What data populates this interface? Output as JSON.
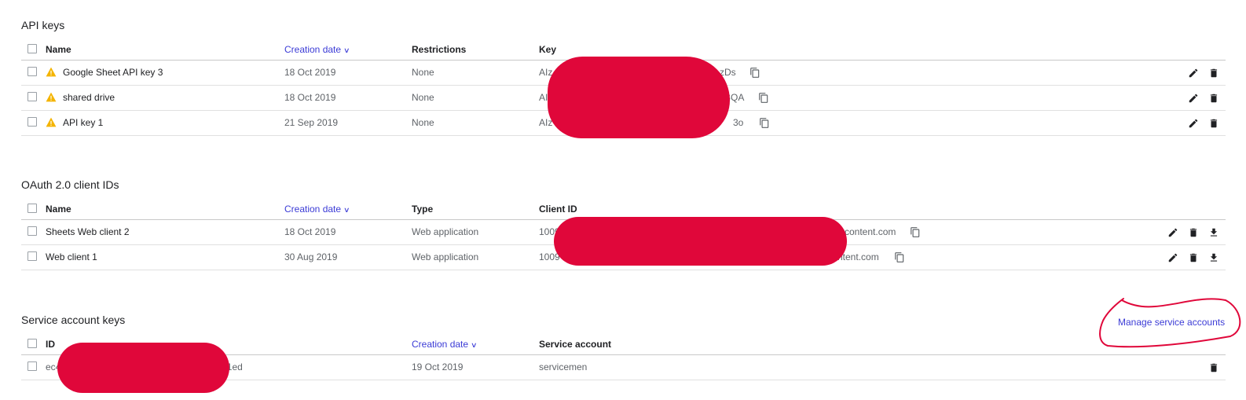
{
  "api_keys": {
    "title": "API keys",
    "headers": {
      "name": "Name",
      "creation_date": "Creation date",
      "restrictions": "Restrictions",
      "key": "Key"
    },
    "rows": [
      {
        "name": "Google Sheet API key 3",
        "date": "18 Oct 2019",
        "restrictions": "None",
        "key_prefix": "AIz",
        "key_suffix": "zDs"
      },
      {
        "name": "shared drive",
        "date": "18 Oct 2019",
        "restrictions": "None",
        "key_prefix": "AI",
        "key_suffix": "BQA"
      },
      {
        "name": "API key 1",
        "date": "21 Sep 2019",
        "restrictions": "None",
        "key_prefix": "AIz",
        "key_suffix": "3o"
      }
    ]
  },
  "oauth": {
    "title": "OAuth 2.0 client IDs",
    "headers": {
      "name": "Name",
      "creation_date": "Creation date",
      "type": "Type",
      "client_id": "Client ID"
    },
    "rows": [
      {
        "name": "Sheets Web client 2",
        "date": "18 Oct 2019",
        "type": "Web application",
        "id_prefix": "1009",
        "id_suffix": "rcontent.com"
      },
      {
        "name": "Web client 1",
        "date": "30 Aug 2019",
        "type": "Web application",
        "id_prefix": "1009",
        "id_suffix": "ntent.com"
      }
    ]
  },
  "service": {
    "title": "Service account keys",
    "manage_link": "Manage service accounts",
    "headers": {
      "id": "ID",
      "creation_date": "Creation date",
      "service_account": "Service account"
    },
    "rows": [
      {
        "id_prefix": "ec4",
        "id_suffix": "11ed",
        "date": "19 Oct 2019",
        "account": "servicemen"
      }
    ]
  },
  "icons": {
    "warning": "warning-icon",
    "copy": "copy-icon",
    "edit": "pencil-icon",
    "delete": "trash-icon",
    "download": "download-icon",
    "sort": "chevron-down-icon"
  },
  "colors": {
    "link": "#3b3bd6",
    "warning": "#f4b400",
    "redaction": "#e0073a",
    "annotation": "#e0073a"
  }
}
